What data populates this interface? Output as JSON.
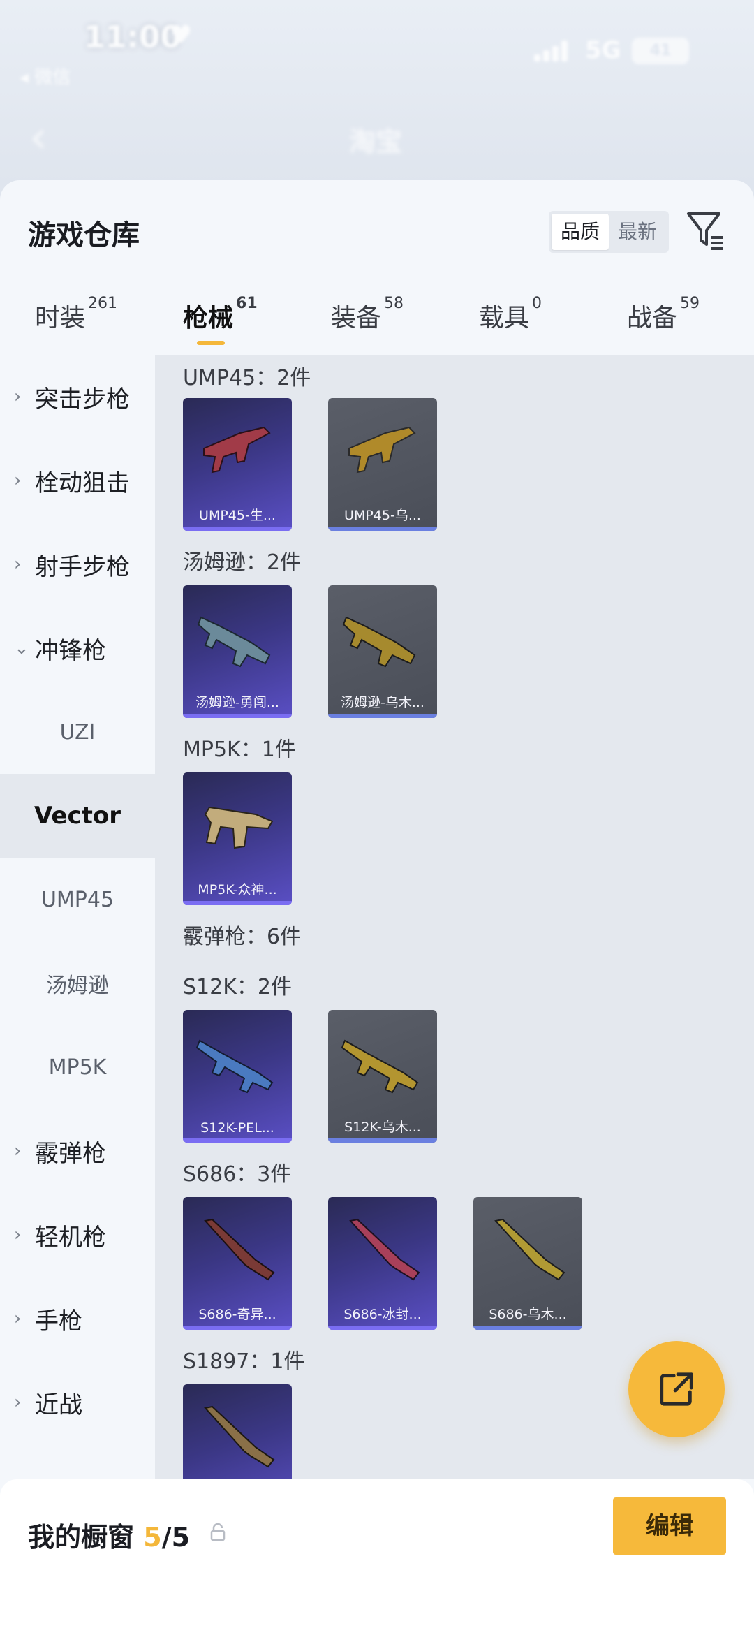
{
  "status": {
    "time": "11:00",
    "network": "5G",
    "battery": "41",
    "back_app": "微信"
  },
  "nav": {
    "title": "淘宝"
  },
  "sheet": {
    "title": "游戏仓库",
    "sort": {
      "quality": "品质",
      "newest": "最新"
    }
  },
  "tabs": [
    {
      "label": "时装",
      "count": "261"
    },
    {
      "label": "枪械",
      "count": "61"
    },
    {
      "label": "装备",
      "count": "58"
    },
    {
      "label": "载具",
      "count": "0"
    },
    {
      "label": "战备",
      "count": "59"
    }
  ],
  "sidebar": {
    "items": [
      {
        "label": "突击步枪"
      },
      {
        "label": "栓动狙击"
      },
      {
        "label": "射手步枪"
      },
      {
        "label": "冲锋枪"
      }
    ],
    "subs": [
      "UZI",
      "Vector",
      "UMP45",
      "汤姆逊",
      "MP5K"
    ],
    "items2": [
      {
        "label": "霰弹枪"
      },
      {
        "label": "轻机枪"
      },
      {
        "label": "手枪"
      },
      {
        "label": "近战"
      }
    ]
  },
  "groups": [
    {
      "header": "UMP45：2件",
      "cards": [
        {
          "name": "UMP45-生..."
        },
        {
          "name": "UMP45-乌..."
        }
      ]
    },
    {
      "header": "汤姆逊：2件",
      "cards": [
        {
          "name": "汤姆逊-勇闯..."
        },
        {
          "name": "汤姆逊-乌木..."
        }
      ]
    },
    {
      "header": "MP5K：1件",
      "cards": [
        {
          "name": "MP5K-众神..."
        }
      ]
    },
    {
      "header": "霰弹枪：6件",
      "cards": []
    },
    {
      "header": "S12K：2件",
      "cards": [
        {
          "name": "S12K-PEL..."
        },
        {
          "name": "S12K-乌木..."
        }
      ]
    },
    {
      "header": "S686：3件",
      "cards": [
        {
          "name": "S686-奇异..."
        },
        {
          "name": "S686-冰封..."
        },
        {
          "name": "S686-乌木..."
        }
      ]
    },
    {
      "header": "S1897：1件",
      "cards": [
        {
          "name": ""
        }
      ]
    }
  ],
  "bottom": {
    "showcase_label": "我的橱窗",
    "current": "5",
    "total": "/5",
    "edit": "编辑"
  },
  "colors": {
    "accent": "#f6b93b",
    "purple_card": "#3b3785",
    "gray_card": "#4a4e58"
  }
}
